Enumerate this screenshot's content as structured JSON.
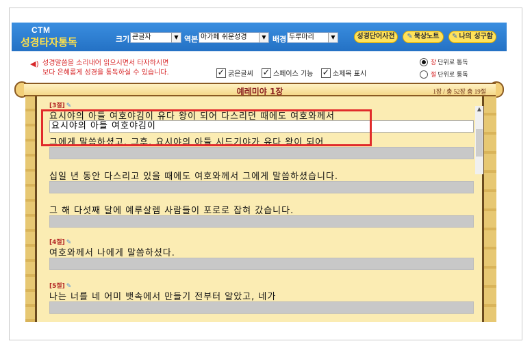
{
  "header": {
    "logo_top": "CTM",
    "logo_main": "성경타자통독",
    "size_label": "크기",
    "size_value": "큰글자",
    "version_label": "역본",
    "version_value": "아가페 쉬운성경",
    "bg_label": "배경",
    "bg_value": "두루마리",
    "btn_dictionary": "성경단어사전",
    "btn_note": "묵상노트",
    "btn_my_verses": "나의 성구함"
  },
  "info": {
    "line1": "성경말씀을 소리내어 읽으시면서 타자하시면",
    "line2": "보다 은혜롭게 성경을 통독하실 수 있습니다.",
    "chk_bold": "굵은글씨",
    "chk_space": "스페이스 기능",
    "chk_subtitle": "소제목 표시",
    "radio_chapter_acc": "장",
    "radio_chapter": "단위로 통독",
    "radio_verse_acc": "절",
    "radio_verse": "단위로 통독"
  },
  "scroll": {
    "chapter_title": "예레미야 1장",
    "chapter_meta": "1장 / 총 52장  총 19절"
  },
  "verses": [
    {
      "label": "[3절]",
      "lines": [
        "요시야의 아들 여호야김이 유다 왕이 되어 다스리던 때에도 여호와께서",
        "그에게 말씀하셨고, 그후, 요시야의 아들 시드기야가 유다 왕이 되어",
        "십일 년 동안 다스리고 있을 때에도 여호와께서 그에게 말씀하셨습니다.",
        "그 해 다섯째 달에 예루살렘 사람들이 포로로 잡혀 갔습니다."
      ],
      "typed": "요시야의 아들 여호야김이"
    },
    {
      "label": "[4절]",
      "lines": [
        "여호와께서 나에게 말씀하셨다."
      ]
    },
    {
      "label": "[5절]",
      "lines": [
        "나는 너를 네 어미 뱃속에서 만들기 전부터 알았고, 네가"
      ]
    }
  ],
  "colors": {
    "header": "#2d7fd3",
    "accent_red": "#d8282a",
    "paper": "#fbecb3",
    "highlight": "#e12b2b"
  }
}
